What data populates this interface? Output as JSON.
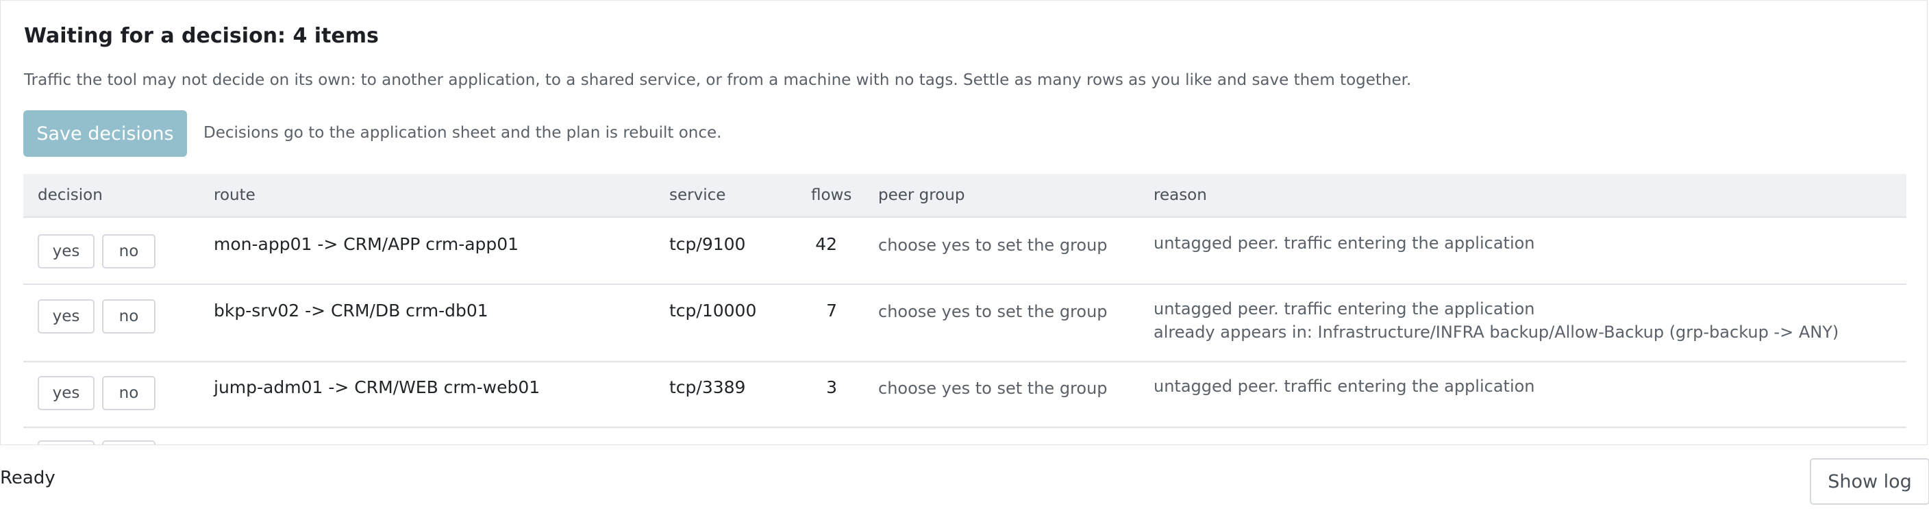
{
  "panel": {
    "title": "Waiting for a decision: 4 items",
    "description": "Traffic the tool may not decide on its own: to another application, to a shared service, or from a machine with no tags. Settle as many rows as you like and save them together.",
    "save_label": "Save decisions",
    "save_hint": "Decisions go to the application sheet and the plan is rebuilt once."
  },
  "table": {
    "headers": {
      "decision": "decision",
      "route": "route",
      "service": "service",
      "flows": "flows",
      "peer_group": "peer group",
      "reason": "reason"
    },
    "rows": [
      {
        "yes": "yes",
        "no": "no",
        "route": "mon-app01 -> CRM/APP crm-app01",
        "service": "tcp/9100",
        "flows": "42",
        "peer_group": "choose yes to set the group",
        "reason": "untagged peer. traffic entering the application",
        "reason2": ""
      },
      {
        "yes": "yes",
        "no": "no",
        "route": "bkp-srv02 -> CRM/DB crm-db01",
        "service": "tcp/10000",
        "flows": "7",
        "peer_group": "choose yes to set the group",
        "reason": "untagged peer. traffic entering the application",
        "reason2": "already appears in: Infrastructure/INFRA backup/Allow-Backup (grp-backup -> ANY)"
      },
      {
        "yes": "yes",
        "no": "no",
        "route": "jump-adm01 -> CRM/WEB crm-web01",
        "service": "tcp/3389",
        "flows": "3",
        "peer_group": "choose yes to set the group",
        "reason": "untagged peer. traffic entering the application",
        "reason2": ""
      }
    ]
  },
  "status": {
    "text": "Ready",
    "log_label": "Show log"
  }
}
